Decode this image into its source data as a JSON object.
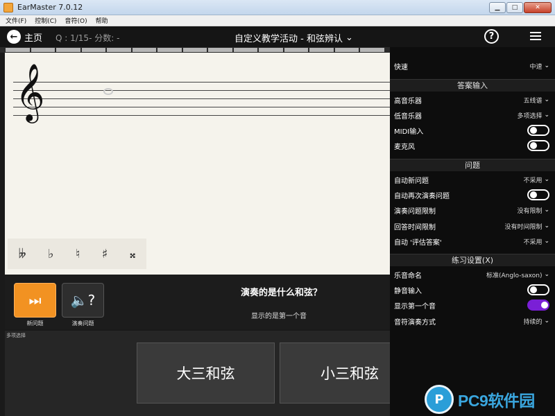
{
  "window": {
    "title": "EarMaster 7.0.12"
  },
  "menu": {
    "items": [
      "文件(F)",
      "控制(C)",
      "音符(O)",
      "帮助"
    ]
  },
  "header": {
    "home_label": "主页",
    "status": "Q : 1/15- 分数: -",
    "title": "自定义教学活动 - 和弦辨认",
    "title_chevron": "⌄",
    "help_glyph": "?"
  },
  "progress": {
    "segment_count": 15,
    "current_question": 1,
    "total_questions": 15
  },
  "staff": {
    "clef_glyph": "𝄞",
    "accidentals": [
      "𝄫",
      "♭",
      "♮",
      "♯",
      "𝄪"
    ]
  },
  "controls": {
    "next_label": "新问题",
    "play_label": "演奏问题",
    "question": "演奏的是什么和弦？",
    "hint": "显示的是第一个音"
  },
  "answers": {
    "label": "多项选择",
    "options": [
      "大三和弦",
      "小三和弦"
    ]
  },
  "panel": {
    "tempo": {
      "label": "快速",
      "value": "中速"
    },
    "section_answer": "答案输入",
    "treble_instrument": {
      "label": "高音乐器",
      "value": "五线谱"
    },
    "bass_instrument": {
      "label": "低音乐器",
      "value": "多项选择"
    },
    "midi_input": {
      "label": "MIDI输入",
      "on": false
    },
    "microphone": {
      "label": "麦克风",
      "on": false
    },
    "section_question": "问题",
    "auto_new": {
      "label": "自动新问题",
      "value": "不采用"
    },
    "auto_replay": {
      "label": "自动再次演奏问题",
      "on": false
    },
    "play_limit": {
      "label": "演奏问题限制",
      "value": "没有限制"
    },
    "answer_time_limit": {
      "label": "回答时间限制",
      "value": "没有时间限制"
    },
    "auto_evaluate": {
      "label": "自动 '评估答案'",
      "value": "不采用"
    },
    "section_practice": "练习设置(X)",
    "note_naming": {
      "label": "乐音命名",
      "value": "标准(Anglo-saxon)"
    },
    "silent_input": {
      "label": "静音输入",
      "on": false
    },
    "show_first_note": {
      "label": "显示第一个音",
      "on": true
    },
    "note_play_mode": {
      "label": "音符演奏方式",
      "value": "持续的"
    }
  },
  "watermark": {
    "logo_text": "P",
    "text": "PC9软件园"
  },
  "colors": {
    "accent_orange": "#f29222",
    "toggle_on": "#7a1fd6",
    "watermark_blue": "#3aa6de"
  }
}
